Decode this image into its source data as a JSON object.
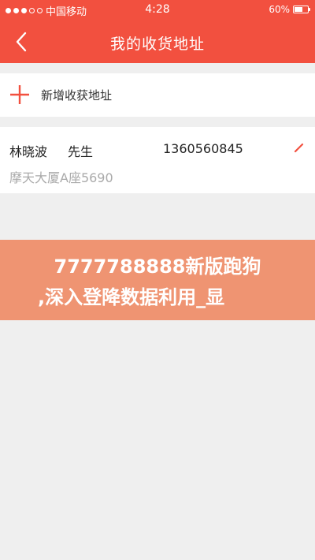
{
  "status_bar": {
    "carrier": "中国移动",
    "time": "4:28",
    "battery_percent": "60%",
    "battery_level": 0.6,
    "signal_filled": 3,
    "signal_total": 5
  },
  "nav": {
    "title": "我的收货地址",
    "back_icon": "chevron-left-icon"
  },
  "add_address": {
    "label": "新增收获地址",
    "icon": "plus-icon"
  },
  "addresses": [
    {
      "name": "林晓波",
      "honorific": "先生",
      "phone": "1360560845",
      "address": "摩天大厦A座5690",
      "edit_icon": "pencil-icon"
    }
  ],
  "banner": {
    "line1": "7777788888新版跑狗",
    "line2": ",深入登降数据利用_显"
  },
  "colors": {
    "brand": "#f2503f",
    "banner": "#ef9472",
    "background": "#efefef"
  }
}
